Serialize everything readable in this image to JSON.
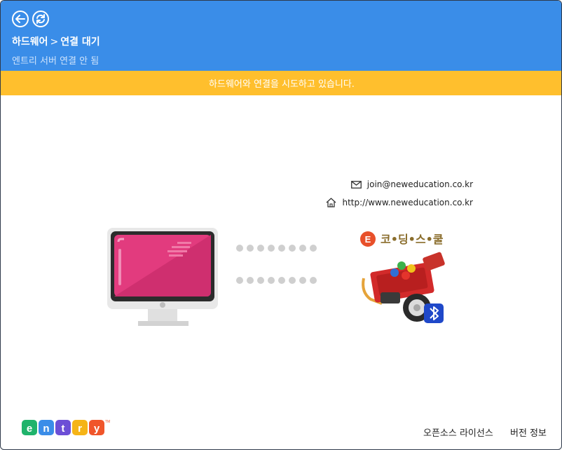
{
  "header": {
    "breadcrumb_root": "하드웨어",
    "breadcrumb_separator": ">",
    "breadcrumb_current": "연결 대기",
    "server_status": "엔트리 서버 연결 안 됨"
  },
  "banner": {
    "message": "하드웨어와 연결을 시도하고 있습니다."
  },
  "contact": {
    "email": "join@neweducation.co.kr",
    "website": "http://www.neweducation.co.kr"
  },
  "device": {
    "brand_text": "코•딩•스•쿨",
    "brand_initial": "E"
  },
  "footer": {
    "logo_letters": [
      "e",
      "n",
      "t",
      "r",
      "y"
    ],
    "license_label": "오픈소스 라이선스",
    "version_label": "버전 정보"
  },
  "colors": {
    "header": "#3a8de8",
    "banner": "#ffbf2d",
    "screen": "#e23b7e",
    "dots": "#cfcfcf"
  },
  "icons": [
    "back-arrow-icon",
    "refresh-icon",
    "mail-icon",
    "home-icon",
    "bluetooth-icon"
  ]
}
